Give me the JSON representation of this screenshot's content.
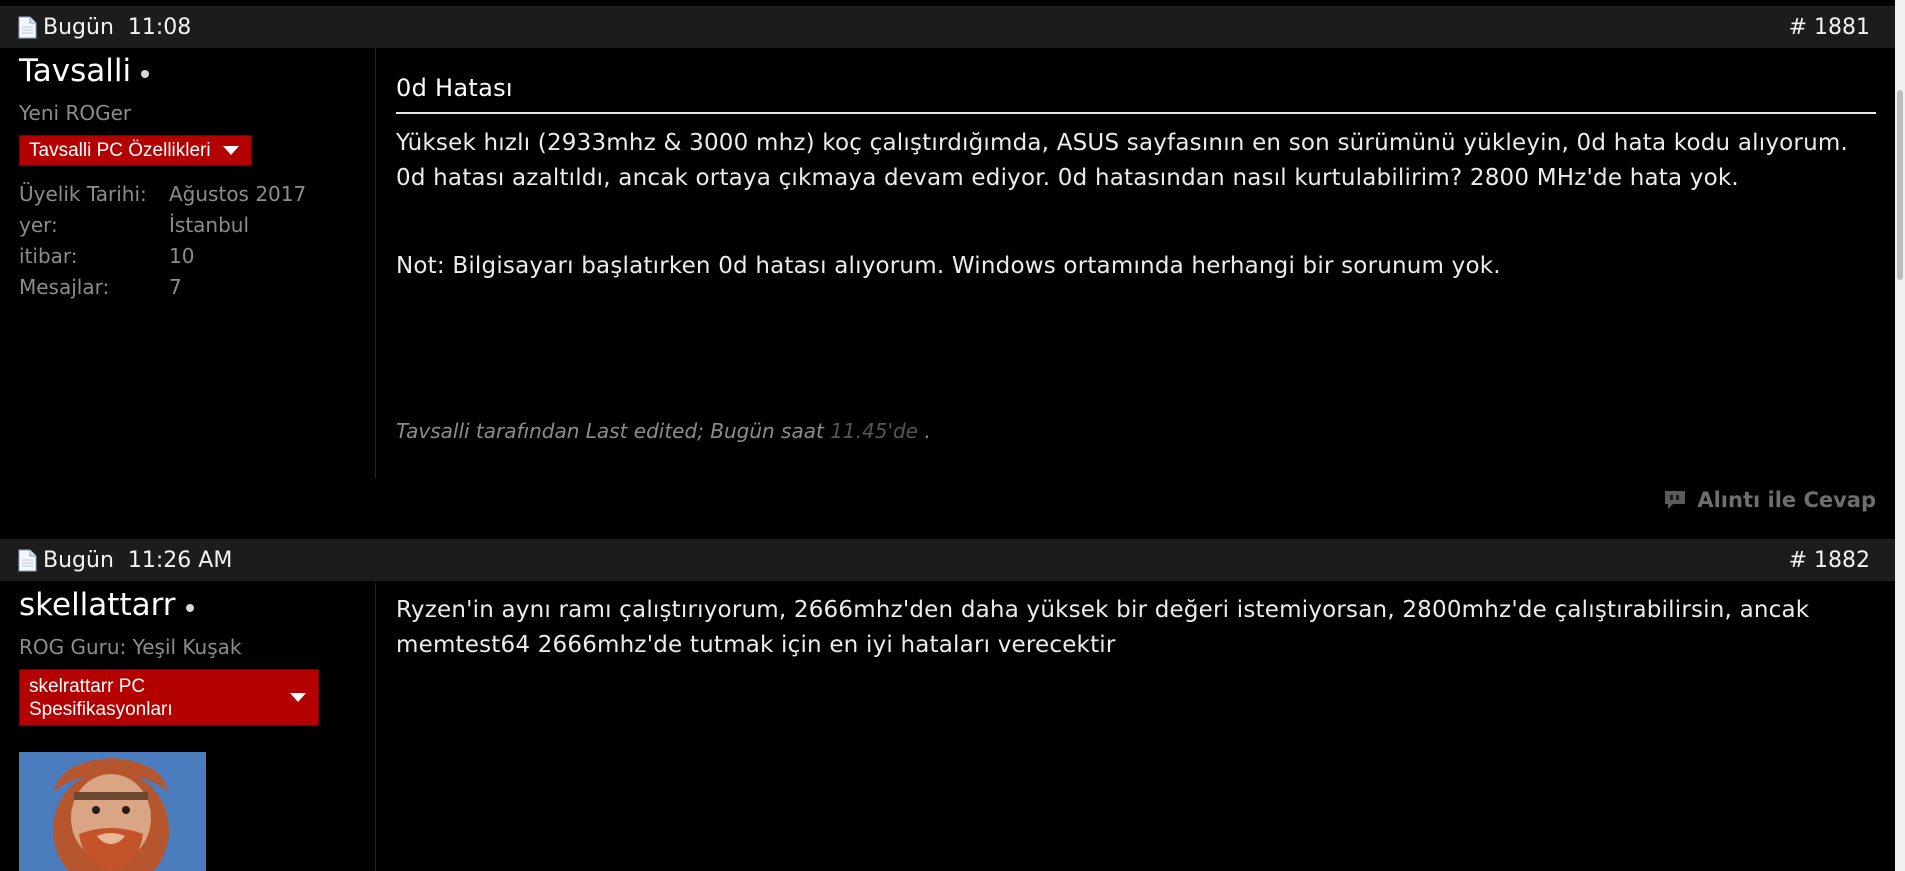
{
  "posts": [
    {
      "date": "Bugün",
      "time": "11:08",
      "number": "# 1881",
      "user": {
        "name": "Tavsalli",
        "title": "Yeni ROGer",
        "specs_label": "Tavsalli PC Özellikleri",
        "stats": [
          {
            "label": "Üyelik Tarihi:",
            "value": "Ağustos 2017"
          },
          {
            "label": "yer:",
            "value": "İstanbul"
          },
          {
            "label": "itibar:",
            "value": "10"
          },
          {
            "label": "Mesajlar:",
            "value": "7"
          }
        ]
      },
      "title": "0d Hatası",
      "body_line1": "Yüksek hızlı (2933mhz & 3000 mhz) koç çalıştırdığımda, ASUS sayfasının en son sürümünü yükleyin, 0d hata kodu alıyorum.",
      "body_line2": "0d hatası azaltıldı, ancak ortaya çıkmaya devam ediyor. 0d hatasından nasıl kurtulabilirim? 2800 MHz'de hata yok.",
      "note": "Not: Bilgisayarı başlatırken 0d hatası alıyorum. Windows ortamında herhangi bir sorunum yok.",
      "edited_prefix": "Tavsalli tarafından Last edited; Bugün saat",
      "edited_time": "11.45'de",
      "edited_suffix": ".",
      "quote_label": "Alıntı ile Cevap"
    },
    {
      "date": "Bugün",
      "time": "11:26 AM",
      "number": "# 1882",
      "user": {
        "name": "skellattarr",
        "title": "ROG Guru: Yeşil Kuşak",
        "specs_line1": "skelrattarr PC",
        "specs_line2": "Spesifikasyonları"
      },
      "body_line1": "Ryzen'in aynı ramı çalıştırıyorum, 2666mhz'den daha yüksek bir değeri istemiyorsan, 2800mhz'de çalıştırabilirsin, ancak",
      "body_line2": "memtest64 2666mhz'de tutmak için en iyi hataları verecektir"
    }
  ],
  "colors": {
    "background": "#000000",
    "header_bar": "#1c1c1c",
    "specs_button": "#b30000",
    "muted_text": "#8c8c8c"
  },
  "icons": [
    "document-icon",
    "online-status-icon",
    "dropdown-arrow-icon",
    "quote-icon"
  ]
}
